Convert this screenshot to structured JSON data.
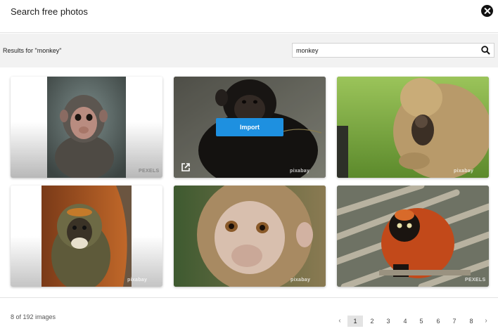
{
  "header": {
    "title": "Search free photos"
  },
  "search": {
    "results_label": "Results for \"monkey\"",
    "query": "monkey"
  },
  "cards": [
    {
      "source_mark": "PEXELS",
      "subject": "baby macaque"
    },
    {
      "source_mark": "pixabay",
      "subject": "chimpanzee",
      "import_label": "Import"
    },
    {
      "source_mark": "pixabay",
      "subject": "mother and baby macaque on grass"
    },
    {
      "source_mark": "pixabay",
      "subject": "De Brazza's monkey on branch"
    },
    {
      "source_mark": "pixabay",
      "subject": "macaque close-up"
    },
    {
      "source_mark": "PEXELS",
      "subject": "red ruffed lemur"
    }
  ],
  "footer": {
    "count": "8 of 192 images",
    "prev": "‹",
    "next": "›",
    "pages": [
      "1",
      "2",
      "3",
      "4",
      "5",
      "6",
      "7",
      "8"
    ],
    "current_page": "1"
  },
  "colors": {
    "accent": "#1e90e0",
    "close_bg": "#111111"
  }
}
